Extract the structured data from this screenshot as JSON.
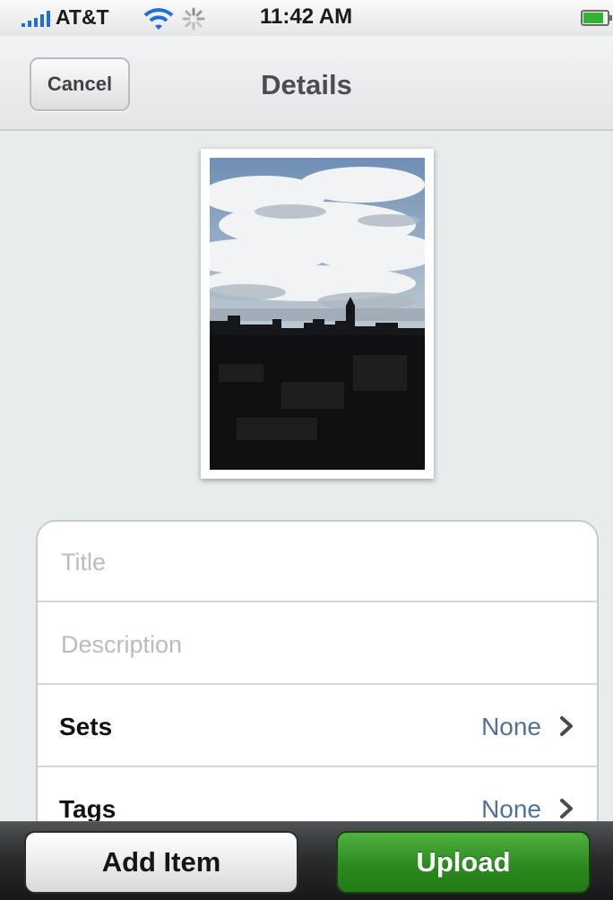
{
  "status_bar": {
    "carrier": "AT&T",
    "time": "11:42 AM",
    "icons": [
      "signal-bars-icon",
      "wifi-icon",
      "activity-spinner-icon",
      "battery-icon"
    ]
  },
  "nav_bar": {
    "cancel_label": "Cancel",
    "title": "Details"
  },
  "form": {
    "title_placeholder": "Title",
    "description_placeholder": "Description",
    "sets": {
      "label": "Sets",
      "value": "None"
    },
    "tags": {
      "label": "Tags",
      "value": "None"
    }
  },
  "toolbar": {
    "add_item_label": "Add Item",
    "upload_label": "Upload"
  },
  "colors": {
    "upload_green": "#2c8a1f",
    "value_blue": "#52709a",
    "background": "#e9eced"
  }
}
